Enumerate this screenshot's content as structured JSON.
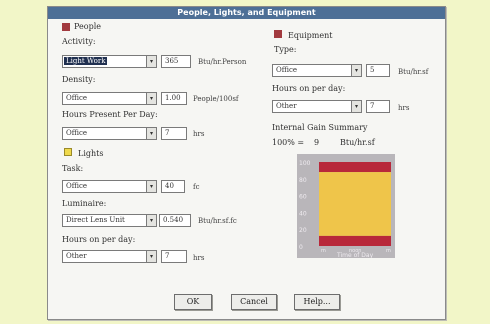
{
  "window": {
    "title": "People, Lights, and Equipment"
  },
  "people": {
    "heading": "People",
    "activity_label": "Activity:",
    "activity_value": "Light Work",
    "activity_number": "365",
    "activity_unit": "Btu/hr.Person",
    "density_label": "Density:",
    "density_value": "Office",
    "density_number": "1.00",
    "density_unit": "People/100sf",
    "hours_label": "Hours Present Per Day:",
    "hours_value": "Office",
    "hours_number": "7",
    "hours_unit": "hrs"
  },
  "lights": {
    "heading": "Lights",
    "task_label": "Task:",
    "task_value": "Office",
    "task_number": "40",
    "task_unit": "fc",
    "luminaire_label": "Luminaire:",
    "luminaire_value": "Direct Lens Unit",
    "luminaire_number": "0.540",
    "luminaire_unit": "Btu/hr.sf.fc",
    "hours_label": "Hours on per day:",
    "hours_value": "Other",
    "hours_number": "7",
    "hours_unit": "hrs"
  },
  "equipment": {
    "heading": "Equipment",
    "type_label": "Type:",
    "type_value": "Office",
    "type_number": "5",
    "type_unit": "Btu/hr.sf",
    "hours_label": "Hours on per day:",
    "hours_value": "Other",
    "hours_number": "7",
    "hours_unit": "hrs"
  },
  "summary": {
    "title": "Internal Gain Summary",
    "pct": "100% =",
    "value": "9",
    "unit": "Btu/hr.sf"
  },
  "chart_data": {
    "type": "area",
    "title": "",
    "xlabel": "Time of Day",
    "ylabel": "",
    "yticks": [
      "100",
      "80",
      "60",
      "40",
      "20",
      "0"
    ],
    "xticks": [
      "m",
      "noon",
      "m"
    ],
    "ylim": [
      0,
      100
    ],
    "series": [
      {
        "color": "#b8283a",
        "values_pct": [
          12
        ]
      },
      {
        "color": "#efc54a",
        "values_pct": [
          76
        ]
      },
      {
        "color": "#b8283a",
        "values_pct": [
          12
        ]
      }
    ]
  },
  "buttons": {
    "ok": "OK",
    "cancel": "Cancel",
    "help": "Help..."
  },
  "colors": {
    "titlebar": "#4d6f96",
    "people_marker": "#a23a3f",
    "lights_marker": "#efd94b",
    "chart_bg": "#b9b6ba"
  }
}
